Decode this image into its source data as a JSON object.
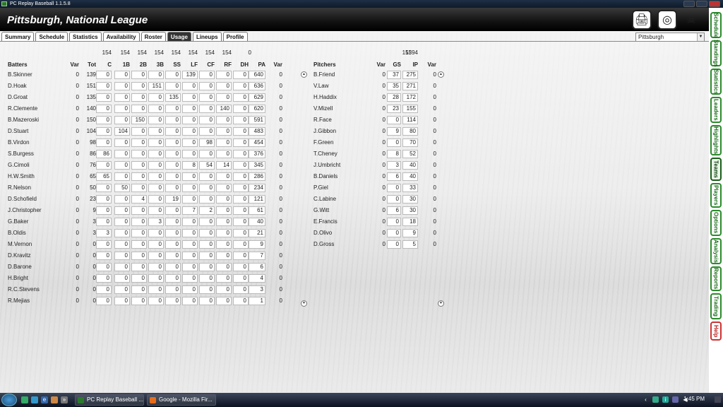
{
  "window": {
    "title": "PC Replay Baseball 1.1.5.8"
  },
  "header": {
    "title": "Pittsburgh, National League"
  },
  "tabs": [
    "Summary",
    "Schedule",
    "Statistics",
    "Availability",
    "Roster",
    "Usage",
    "Lineups",
    "Profile"
  ],
  "active_tab": "Usage",
  "team_select": {
    "value": "Pittsburgh"
  },
  "side_tabs": [
    "Schedule",
    "Standings",
    "Statistics",
    "Leaders",
    "Highlights",
    "Teams",
    "Players",
    "Options",
    "Analysis",
    "Reports",
    "Trading",
    "Help"
  ],
  "active_side_tab": "Teams",
  "batters": {
    "header": [
      "Batters",
      "Var",
      "Tot",
      "C",
      "1B",
      "2B",
      "3B",
      "SS",
      "LF",
      "CF",
      "RF",
      "DH",
      "PA",
      "Var"
    ],
    "totals": [
      "154",
      "154",
      "154",
      "154",
      "154",
      "154",
      "154",
      "154",
      "0"
    ],
    "rows": [
      [
        "B.Skinner",
        "0",
        "139",
        "0",
        "0",
        "0",
        "0",
        "0",
        "139",
        "0",
        "0",
        "0",
        "640",
        "0"
      ],
      [
        "D.Hoak",
        "0",
        "151",
        "0",
        "0",
        "0",
        "151",
        "0",
        "0",
        "0",
        "0",
        "0",
        "636",
        "0"
      ],
      [
        "D.Groat",
        "0",
        "135",
        "0",
        "0",
        "0",
        "0",
        "135",
        "0",
        "0",
        "0",
        "0",
        "629",
        "0"
      ],
      [
        "R.Clemente",
        "0",
        "140",
        "0",
        "0",
        "0",
        "0",
        "0",
        "0",
        "0",
        "140",
        "0",
        "620",
        "0"
      ],
      [
        "B.Mazeroski",
        "0",
        "150",
        "0",
        "0",
        "150",
        "0",
        "0",
        "0",
        "0",
        "0",
        "0",
        "591",
        "0"
      ],
      [
        "D.Stuart",
        "0",
        "104",
        "0",
        "104",
        "0",
        "0",
        "0",
        "0",
        "0",
        "0",
        "0",
        "483",
        "0"
      ],
      [
        "B.Virdon",
        "0",
        "98",
        "0",
        "0",
        "0",
        "0",
        "0",
        "0",
        "98",
        "0",
        "0",
        "454",
        "0"
      ],
      [
        "S.Burgess",
        "0",
        "86",
        "86",
        "0",
        "0",
        "0",
        "0",
        "0",
        "0",
        "0",
        "0",
        "376",
        "0"
      ],
      [
        "G.Cimoli",
        "0",
        "76",
        "0",
        "0",
        "0",
        "0",
        "0",
        "8",
        "54",
        "14",
        "0",
        "345",
        "0"
      ],
      [
        "H.W.Smith",
        "0",
        "65",
        "65",
        "0",
        "0",
        "0",
        "0",
        "0",
        "0",
        "0",
        "0",
        "286",
        "0"
      ],
      [
        "R.Nelson",
        "0",
        "50",
        "0",
        "50",
        "0",
        "0",
        "0",
        "0",
        "0",
        "0",
        "0",
        "234",
        "0"
      ],
      [
        "D.Schofield",
        "0",
        "23",
        "0",
        "0",
        "4",
        "0",
        "19",
        "0",
        "0",
        "0",
        "0",
        "121",
        "0"
      ],
      [
        "J.Christopher",
        "0",
        "9",
        "0",
        "0",
        "0",
        "0",
        "0",
        "7",
        "2",
        "0",
        "0",
        "61",
        "0"
      ],
      [
        "G.Baker",
        "0",
        "3",
        "0",
        "0",
        "0",
        "3",
        "0",
        "0",
        "0",
        "0",
        "0",
        "40",
        "0"
      ],
      [
        "B.Oldis",
        "0",
        "3",
        "3",
        "0",
        "0",
        "0",
        "0",
        "0",
        "0",
        "0",
        "0",
        "21",
        "0"
      ],
      [
        "M.Vernon",
        "0",
        "0",
        "0",
        "0",
        "0",
        "0",
        "0",
        "0",
        "0",
        "0",
        "0",
        "9",
        "0"
      ],
      [
        "D.Kravitz",
        "0",
        "0",
        "0",
        "0",
        "0",
        "0",
        "0",
        "0",
        "0",
        "0",
        "0",
        "7",
        "0"
      ],
      [
        "D.Barone",
        "0",
        "0",
        "0",
        "0",
        "0",
        "0",
        "0",
        "0",
        "0",
        "0",
        "0",
        "6",
        "0"
      ],
      [
        "H.Bright",
        "0",
        "0",
        "0",
        "0",
        "0",
        "0",
        "0",
        "0",
        "0",
        "0",
        "0",
        "4",
        "0"
      ],
      [
        "R.C.Stevens",
        "0",
        "0",
        "0",
        "0",
        "0",
        "0",
        "0",
        "0",
        "0",
        "0",
        "0",
        "3",
        "0"
      ],
      [
        "R.Mejias",
        "0",
        "0",
        "0",
        "0",
        "0",
        "0",
        "0",
        "0",
        "0",
        "0",
        "0",
        "1",
        "0"
      ]
    ]
  },
  "pitchers": {
    "header": [
      "Pitchers",
      "Var",
      "GS",
      "IP",
      "Var"
    ],
    "totals": [
      "155",
      "1394"
    ],
    "rows": [
      [
        "B.Friend",
        "0",
        "37",
        "275",
        "0"
      ],
      [
        "V.Law",
        "0",
        "35",
        "271",
        "0"
      ],
      [
        "H.Haddix",
        "0",
        "28",
        "172",
        "0"
      ],
      [
        "V.Mizell",
        "0",
        "23",
        "155",
        "0"
      ],
      [
        "R.Face",
        "0",
        "0",
        "114",
        "0"
      ],
      [
        "J.Gibbon",
        "0",
        "9",
        "80",
        "0"
      ],
      [
        "F.Green",
        "0",
        "0",
        "70",
        "0"
      ],
      [
        "T.Cheney",
        "0",
        "8",
        "52",
        "0"
      ],
      [
        "J.Umbricht",
        "0",
        "3",
        "40",
        "0"
      ],
      [
        "B.Daniels",
        "0",
        "6",
        "40",
        "0"
      ],
      [
        "P.Giel",
        "0",
        "0",
        "33",
        "0"
      ],
      [
        "C.Labine",
        "0",
        "0",
        "30",
        "0"
      ],
      [
        "G.Witt",
        "0",
        "6",
        "30",
        "0"
      ],
      [
        "E.Francis",
        "0",
        "0",
        "18",
        "0"
      ],
      [
        "D.Olivo",
        "0",
        "0",
        "9",
        "0"
      ],
      [
        "D.Gross",
        "0",
        "0",
        "5",
        "0"
      ]
    ]
  },
  "taskbar": {
    "items": [
      "PC Replay Baseball ...",
      "Google - Mozilla Fir..."
    ],
    "clock": "1:45 PM"
  },
  "colors": {
    "accent": "#2b8a2b",
    "header_bg": "#111111",
    "help_tab": "#cc3333"
  }
}
